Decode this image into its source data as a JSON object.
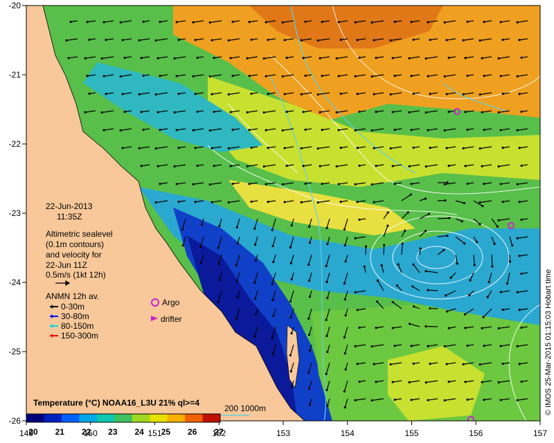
{
  "map": {
    "lon_ticks": [
      "149",
      "150",
      "151",
      "152",
      "153",
      "154",
      "155",
      "156",
      "157"
    ],
    "lat_ticks": [
      "-20",
      "-21",
      "-22",
      "-23",
      "-24",
      "-25",
      "-26"
    ],
    "date": "22-Jun-2013",
    "time": "11:35Z",
    "altimetry_note": [
      "Altimetric sealevel",
      "(0.1m contours)",
      "and velocity for",
      "22-Jun 11Z"
    ],
    "velocity_scale": "0.5m/s (1kt 12h)",
    "anmn_title": "ANMN 12h av.",
    "anmn_depths": [
      {
        "label": "0-30m",
        "color": "#000000"
      },
      {
        "label": "30-80m",
        "color": "#0000ff"
      },
      {
        "label": "80-150m",
        "color": "#00d8d8"
      },
      {
        "label": "150-300m",
        "color": "#ff0000"
      }
    ],
    "argo_label": "Argo",
    "drifter_label": "drifter",
    "colorbar_title": "Temperature (°C) NOAA16_L3U 21% ql>=4",
    "colorbar_ticks": [
      "20",
      "21",
      "22",
      "23",
      "24",
      "25",
      "26",
      "27"
    ],
    "isobath_label": "200  1000m",
    "credit": "© IMOS 25-Mar-2015 01:15:03 Hobart time",
    "colors": {
      "land": "#f8c89a",
      "ocean_warm": "#f08c10",
      "ocean_mid": "#8fd630",
      "ocean_cool": "#28b0c8",
      "ocean_cold": "#0a1a9a",
      "argo": "#d020d0",
      "isobath": "#5fd0e0"
    },
    "colorbar_colors": [
      "#00007a",
      "#0020c0",
      "#0060ff",
      "#00a8e8",
      "#10c8b0",
      "#40c060",
      "#a0d820",
      "#e8e000",
      "#f8b000",
      "#f06000",
      "#c01000"
    ]
  }
}
